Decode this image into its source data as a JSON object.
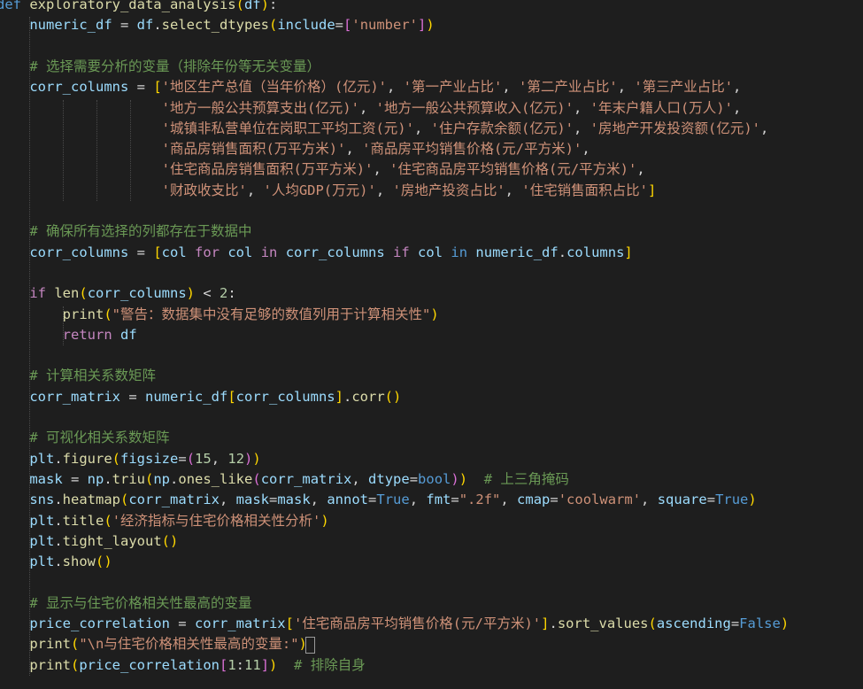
{
  "colors": {
    "background": "#1e1e1e",
    "keyword": "#569cd6",
    "control": "#c586c0",
    "function": "#dcdcaa",
    "variable": "#9cdcfe",
    "string": "#ce9178",
    "comment": "#6a9955",
    "number": "#b5cea8",
    "plain": "#d4d4d4",
    "bracket1": "#ffd700",
    "bracket2": "#da70d6",
    "bracket3": "#179fff"
  },
  "code_lines": [
    [
      {
        "t": "def ",
        "c": "keyword"
      },
      {
        "t": "exploratory_data_analysis",
        "c": "function"
      },
      {
        "t": "(",
        "c": "bracket1"
      },
      {
        "t": "df",
        "c": "variable"
      },
      {
        "t": ")",
        "c": "bracket1"
      },
      {
        "t": ":",
        "c": "plain"
      }
    ],
    [
      {
        "t": "    ",
        "c": "plain"
      },
      {
        "t": "numeric_df",
        "c": "variable"
      },
      {
        "t": " = ",
        "c": "plain"
      },
      {
        "t": "df",
        "c": "variable"
      },
      {
        "t": ".",
        "c": "plain"
      },
      {
        "t": "select_dtypes",
        "c": "function"
      },
      {
        "t": "(",
        "c": "bracket1"
      },
      {
        "t": "include",
        "c": "variable"
      },
      {
        "t": "=",
        "c": "plain"
      },
      {
        "t": "[",
        "c": "bracket2"
      },
      {
        "t": "'number'",
        "c": "string"
      },
      {
        "t": "]",
        "c": "bracket2"
      },
      {
        "t": ")",
        "c": "bracket1"
      }
    ],
    [],
    [
      {
        "t": "    ",
        "c": "plain"
      },
      {
        "t": "# 选择需要分析的变量（排除年份等无关变量）",
        "c": "comment"
      }
    ],
    [
      {
        "t": "    ",
        "c": "plain"
      },
      {
        "t": "corr_columns",
        "c": "variable"
      },
      {
        "t": " = ",
        "c": "plain"
      },
      {
        "t": "[",
        "c": "bracket1"
      },
      {
        "t": "'地区生产总值（当年价格）(亿元)'",
        "c": "string"
      },
      {
        "t": ", ",
        "c": "plain"
      },
      {
        "t": "'第一产业占比'",
        "c": "string"
      },
      {
        "t": ", ",
        "c": "plain"
      },
      {
        "t": "'第二产业占比'",
        "c": "string"
      },
      {
        "t": ", ",
        "c": "plain"
      },
      {
        "t": "'第三产业占比'",
        "c": "string"
      },
      {
        "t": ",",
        "c": "plain"
      }
    ],
    [
      {
        "t": "                    ",
        "c": "plain"
      },
      {
        "t": "'地方一般公共预算支出(亿元)'",
        "c": "string"
      },
      {
        "t": ", ",
        "c": "plain"
      },
      {
        "t": "'地方一般公共预算收入(亿元)'",
        "c": "string"
      },
      {
        "t": ", ",
        "c": "plain"
      },
      {
        "t": "'年末户籍人口(万人)'",
        "c": "string"
      },
      {
        "t": ",",
        "c": "plain"
      }
    ],
    [
      {
        "t": "                    ",
        "c": "plain"
      },
      {
        "t": "'城镇非私营单位在岗职工平均工资(元)'",
        "c": "string"
      },
      {
        "t": ", ",
        "c": "plain"
      },
      {
        "t": "'住户存款余额(亿元)'",
        "c": "string"
      },
      {
        "t": ", ",
        "c": "plain"
      },
      {
        "t": "'房地产开发投资额(亿元)'",
        "c": "string"
      },
      {
        "t": ",",
        "c": "plain"
      }
    ],
    [
      {
        "t": "                    ",
        "c": "plain"
      },
      {
        "t": "'商品房销售面积(万平方米)'",
        "c": "string"
      },
      {
        "t": ", ",
        "c": "plain"
      },
      {
        "t": "'商品房平均销售价格(元/平方米)'",
        "c": "string"
      },
      {
        "t": ",",
        "c": "plain"
      }
    ],
    [
      {
        "t": "                    ",
        "c": "plain"
      },
      {
        "t": "'住宅商品房销售面积(万平方米)'",
        "c": "string"
      },
      {
        "t": ", ",
        "c": "plain"
      },
      {
        "t": "'住宅商品房平均销售价格(元/平方米)'",
        "c": "string"
      },
      {
        "t": ",",
        "c": "plain"
      }
    ],
    [
      {
        "t": "                    ",
        "c": "plain"
      },
      {
        "t": "'财政收支比'",
        "c": "string"
      },
      {
        "t": ", ",
        "c": "plain"
      },
      {
        "t": "'人均GDP(万元)'",
        "c": "string"
      },
      {
        "t": ", ",
        "c": "plain"
      },
      {
        "t": "'房地产投资占比'",
        "c": "string"
      },
      {
        "t": ", ",
        "c": "plain"
      },
      {
        "t": "'住宅销售面积占比'",
        "c": "string"
      },
      {
        "t": "]",
        "c": "bracket1"
      }
    ],
    [],
    [
      {
        "t": "    ",
        "c": "plain"
      },
      {
        "t": "# 确保所有选择的列都存在于数据中",
        "c": "comment"
      }
    ],
    [
      {
        "t": "    ",
        "c": "plain"
      },
      {
        "t": "corr_columns",
        "c": "variable"
      },
      {
        "t": " = ",
        "c": "plain"
      },
      {
        "t": "[",
        "c": "bracket1"
      },
      {
        "t": "col",
        "c": "variable"
      },
      {
        "t": " ",
        "c": "plain"
      },
      {
        "t": "for",
        "c": "control"
      },
      {
        "t": " ",
        "c": "plain"
      },
      {
        "t": "col",
        "c": "variable"
      },
      {
        "t": " ",
        "c": "plain"
      },
      {
        "t": "in",
        "c": "control"
      },
      {
        "t": " ",
        "c": "plain"
      },
      {
        "t": "corr_columns",
        "c": "variable"
      },
      {
        "t": " ",
        "c": "plain"
      },
      {
        "t": "if",
        "c": "control"
      },
      {
        "t": " ",
        "c": "plain"
      },
      {
        "t": "col",
        "c": "variable"
      },
      {
        "t": " ",
        "c": "plain"
      },
      {
        "t": "in",
        "c": "keyword"
      },
      {
        "t": " ",
        "c": "plain"
      },
      {
        "t": "numeric_df",
        "c": "variable"
      },
      {
        "t": ".",
        "c": "plain"
      },
      {
        "t": "columns",
        "c": "variable"
      },
      {
        "t": "]",
        "c": "bracket1"
      }
    ],
    [],
    [
      {
        "t": "    ",
        "c": "plain"
      },
      {
        "t": "if",
        "c": "control"
      },
      {
        "t": " ",
        "c": "plain"
      },
      {
        "t": "len",
        "c": "function"
      },
      {
        "t": "(",
        "c": "bracket1"
      },
      {
        "t": "corr_columns",
        "c": "variable"
      },
      {
        "t": ")",
        "c": "bracket1"
      },
      {
        "t": " < ",
        "c": "plain"
      },
      {
        "t": "2",
        "c": "number"
      },
      {
        "t": ":",
        "c": "plain"
      }
    ],
    [
      {
        "t": "        ",
        "c": "plain"
      },
      {
        "t": "print",
        "c": "function"
      },
      {
        "t": "(",
        "c": "bracket1"
      },
      {
        "t": "\"警告：数据集中没有足够的数值列用于计算相关性\"",
        "c": "string"
      },
      {
        "t": ")",
        "c": "bracket1"
      }
    ],
    [
      {
        "t": "        ",
        "c": "plain"
      },
      {
        "t": "return",
        "c": "control"
      },
      {
        "t": " ",
        "c": "plain"
      },
      {
        "t": "df",
        "c": "variable"
      }
    ],
    [],
    [
      {
        "t": "    ",
        "c": "plain"
      },
      {
        "t": "# 计算相关系数矩阵",
        "c": "comment"
      }
    ],
    [
      {
        "t": "    ",
        "c": "plain"
      },
      {
        "t": "corr_matrix",
        "c": "variable"
      },
      {
        "t": " = ",
        "c": "plain"
      },
      {
        "t": "numeric_df",
        "c": "variable"
      },
      {
        "t": "[",
        "c": "bracket1"
      },
      {
        "t": "corr_columns",
        "c": "variable"
      },
      {
        "t": "]",
        "c": "bracket1"
      },
      {
        "t": ".",
        "c": "plain"
      },
      {
        "t": "corr",
        "c": "function"
      },
      {
        "t": "(",
        "c": "bracket1"
      },
      {
        "t": ")",
        "c": "bracket1"
      }
    ],
    [],
    [
      {
        "t": "    ",
        "c": "plain"
      },
      {
        "t": "# 可视化相关系数矩阵",
        "c": "comment"
      }
    ],
    [
      {
        "t": "    ",
        "c": "plain"
      },
      {
        "t": "plt",
        "c": "variable"
      },
      {
        "t": ".",
        "c": "plain"
      },
      {
        "t": "figure",
        "c": "function"
      },
      {
        "t": "(",
        "c": "bracket1"
      },
      {
        "t": "figsize",
        "c": "variable"
      },
      {
        "t": "=",
        "c": "plain"
      },
      {
        "t": "(",
        "c": "bracket2"
      },
      {
        "t": "15",
        "c": "number"
      },
      {
        "t": ", ",
        "c": "plain"
      },
      {
        "t": "12",
        "c": "number"
      },
      {
        "t": ")",
        "c": "bracket2"
      },
      {
        "t": ")",
        "c": "bracket1"
      }
    ],
    [
      {
        "t": "    ",
        "c": "plain"
      },
      {
        "t": "mask",
        "c": "variable"
      },
      {
        "t": " = ",
        "c": "plain"
      },
      {
        "t": "np",
        "c": "variable"
      },
      {
        "t": ".",
        "c": "plain"
      },
      {
        "t": "triu",
        "c": "function"
      },
      {
        "t": "(",
        "c": "bracket1"
      },
      {
        "t": "np",
        "c": "variable"
      },
      {
        "t": ".",
        "c": "plain"
      },
      {
        "t": "ones_like",
        "c": "function"
      },
      {
        "t": "(",
        "c": "bracket2"
      },
      {
        "t": "corr_matrix",
        "c": "variable"
      },
      {
        "t": ", ",
        "c": "plain"
      },
      {
        "t": "dtype",
        "c": "variable"
      },
      {
        "t": "=",
        "c": "plain"
      },
      {
        "t": "bool",
        "c": "keyword"
      },
      {
        "t": ")",
        "c": "bracket2"
      },
      {
        "t": ")",
        "c": "bracket1"
      },
      {
        "t": "  ",
        "c": "plain"
      },
      {
        "t": "# 上三角掩码",
        "c": "comment"
      }
    ],
    [
      {
        "t": "    ",
        "c": "plain"
      },
      {
        "t": "sns",
        "c": "variable"
      },
      {
        "t": ".",
        "c": "plain"
      },
      {
        "t": "heatmap",
        "c": "function"
      },
      {
        "t": "(",
        "c": "bracket1"
      },
      {
        "t": "corr_matrix",
        "c": "variable"
      },
      {
        "t": ", ",
        "c": "plain"
      },
      {
        "t": "mask",
        "c": "variable"
      },
      {
        "t": "=",
        "c": "plain"
      },
      {
        "t": "mask",
        "c": "variable"
      },
      {
        "t": ", ",
        "c": "plain"
      },
      {
        "t": "annot",
        "c": "variable"
      },
      {
        "t": "=",
        "c": "plain"
      },
      {
        "t": "True",
        "c": "keyword"
      },
      {
        "t": ", ",
        "c": "plain"
      },
      {
        "t": "fmt",
        "c": "variable"
      },
      {
        "t": "=",
        "c": "plain"
      },
      {
        "t": "\".2f\"",
        "c": "string"
      },
      {
        "t": ", ",
        "c": "plain"
      },
      {
        "t": "cmap",
        "c": "variable"
      },
      {
        "t": "=",
        "c": "plain"
      },
      {
        "t": "'coolwarm'",
        "c": "string"
      },
      {
        "t": ", ",
        "c": "plain"
      },
      {
        "t": "square",
        "c": "variable"
      },
      {
        "t": "=",
        "c": "plain"
      },
      {
        "t": "True",
        "c": "keyword"
      },
      {
        "t": ")",
        "c": "bracket1"
      }
    ],
    [
      {
        "t": "    ",
        "c": "plain"
      },
      {
        "t": "plt",
        "c": "variable"
      },
      {
        "t": ".",
        "c": "plain"
      },
      {
        "t": "title",
        "c": "function"
      },
      {
        "t": "(",
        "c": "bracket1"
      },
      {
        "t": "'经济指标与住宅价格相关性分析'",
        "c": "string"
      },
      {
        "t": ")",
        "c": "bracket1"
      }
    ],
    [
      {
        "t": "    ",
        "c": "plain"
      },
      {
        "t": "plt",
        "c": "variable"
      },
      {
        "t": ".",
        "c": "plain"
      },
      {
        "t": "tight_layout",
        "c": "function"
      },
      {
        "t": "(",
        "c": "bracket1"
      },
      {
        "t": ")",
        "c": "bracket1"
      }
    ],
    [
      {
        "t": "    ",
        "c": "plain"
      },
      {
        "t": "plt",
        "c": "variable"
      },
      {
        "t": ".",
        "c": "plain"
      },
      {
        "t": "show",
        "c": "function"
      },
      {
        "t": "(",
        "c": "bracket1"
      },
      {
        "t": ")",
        "c": "bracket1"
      }
    ],
    [],
    [
      {
        "t": "    ",
        "c": "plain"
      },
      {
        "t": "# 显示与住宅价格相关性最高的变量",
        "c": "comment"
      }
    ],
    [
      {
        "t": "    ",
        "c": "plain"
      },
      {
        "t": "price_correlation",
        "c": "variable"
      },
      {
        "t": " = ",
        "c": "plain"
      },
      {
        "t": "corr_matrix",
        "c": "variable"
      },
      {
        "t": "[",
        "c": "bracket1"
      },
      {
        "t": "'住宅商品房平均销售价格(元/平方米)'",
        "c": "string"
      },
      {
        "t": "]",
        "c": "bracket1"
      },
      {
        "t": ".",
        "c": "plain"
      },
      {
        "t": "sort_values",
        "c": "function"
      },
      {
        "t": "(",
        "c": "bracket1"
      },
      {
        "t": "ascending",
        "c": "variable"
      },
      {
        "t": "=",
        "c": "plain"
      },
      {
        "t": "False",
        "c": "keyword"
      },
      {
        "t": ")",
        "c": "bracket1"
      }
    ],
    [
      {
        "t": "    ",
        "c": "plain"
      },
      {
        "t": "print",
        "c": "function"
      },
      {
        "t": "(",
        "c": "bracket1"
      },
      {
        "t": "\"\\n与住宅价格相关性最高的变量:",
        "c": "string"
      },
      {
        "t": "\"",
        "c": "string"
      },
      {
        "t": ")",
        "c": "bracket1"
      }
    ],
    [
      {
        "t": "    ",
        "c": "plain"
      },
      {
        "t": "print",
        "c": "function"
      },
      {
        "t": "(",
        "c": "bracket1"
      },
      {
        "t": "price_correlation",
        "c": "variable"
      },
      {
        "t": "[",
        "c": "bracket2"
      },
      {
        "t": "1",
        "c": "number"
      },
      {
        "t": ":",
        "c": "plain"
      },
      {
        "t": "11",
        "c": "number"
      },
      {
        "t": "]",
        "c": "bracket2"
      },
      {
        "t": ")",
        "c": "bracket1"
      },
      {
        "t": "  ",
        "c": "plain"
      },
      {
        "t": "# 排除自身",
        "c": "comment"
      }
    ]
  ]
}
